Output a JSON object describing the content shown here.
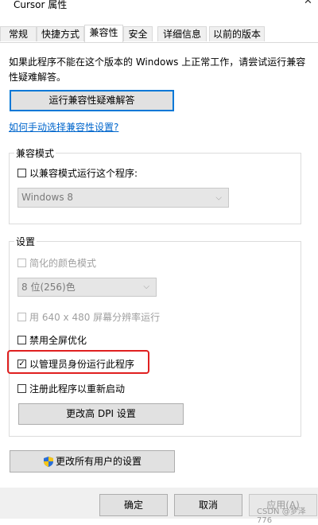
{
  "window": {
    "title": "Cursor 属性",
    "close_glyph": "✕"
  },
  "tabs": [
    {
      "label": "常规"
    },
    {
      "label": "快捷方式"
    },
    {
      "label": "兼容性"
    },
    {
      "label": "安全"
    },
    {
      "label": "详细信息"
    },
    {
      "label": "以前的版本"
    }
  ],
  "active_tab": "兼容性",
  "intro": {
    "text": "如果此程序不能在这个版本的 Windows 上正常工作，请尝试运行兼容性疑难解答。"
  },
  "troubleshooter_button": "运行兼容性疑难解答",
  "manual_link": "如何手动选择兼容性设置?",
  "compat_mode": {
    "legend": "兼容模式",
    "checkbox_label": "以兼容模式运行这个程序:",
    "checked": false,
    "os_select_value": "Windows 8"
  },
  "settings": {
    "legend": "设置",
    "reduced_color_label": "简化的颜色模式",
    "color_select_value": "8 位(256)色",
    "res_640_label": "用 640 x 480 屏幕分辨率运行",
    "disable_fullscreen_opt_label": "禁用全屏优化",
    "run_as_admin_label": "以管理员身份运行此程序",
    "run_as_admin_checked": true,
    "register_restart_label": "注册此程序以重新启动",
    "dpi_button": "更改高 DPI 设置"
  },
  "all_users_button": "更改所有用户的设置",
  "footer": {
    "ok": "确定",
    "cancel": "取消",
    "apply": "应用(A)",
    "watermark": "CSDN @梦泽776"
  },
  "colors": {
    "highlight_border": "#e02020",
    "link": "#0066cc",
    "focus_border": "#0078d7"
  }
}
